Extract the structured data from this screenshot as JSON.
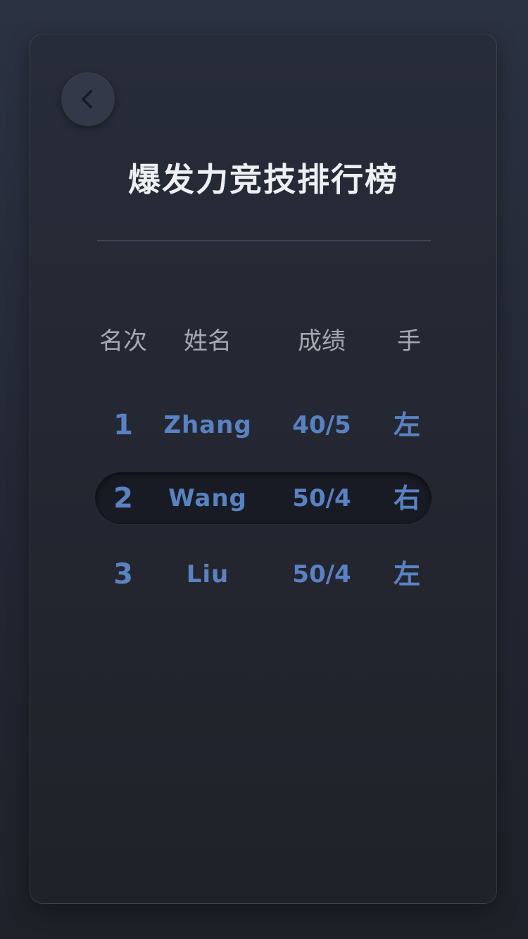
{
  "header": {
    "back_icon": "chevron-left-icon",
    "title": "爆发力竞技排行榜"
  },
  "leaderboard": {
    "columns": [
      "名次",
      "姓名",
      "成绩",
      "手"
    ],
    "rows": [
      {
        "rank": "1",
        "name": "Zhang",
        "score": "40/5",
        "hand": "左",
        "highlighted": false
      },
      {
        "rank": "2",
        "name": "Wang",
        "score": "50/4",
        "hand": "右",
        "highlighted": true
      },
      {
        "rank": "3",
        "name": "Liu",
        "score": "50/4",
        "hand": "左",
        "highlighted": false
      }
    ]
  },
  "colors": {
    "background": "#262a34",
    "card": "#252933",
    "accent": "#5a82c2",
    "title": "#eeeff2",
    "header_text": "#a6a9b0",
    "highlight_row": "#181b23"
  }
}
